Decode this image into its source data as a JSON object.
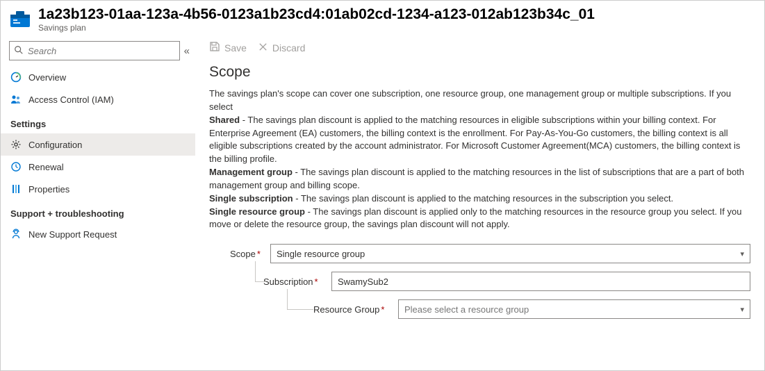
{
  "header": {
    "title": "1a23b123-01aa-123a-4b56-0123a1b23cd4:01ab02cd-1234-a123-012ab123b34c_01",
    "subtitle": "Savings plan"
  },
  "sidebar": {
    "search_placeholder": "Search",
    "items": {
      "overview": "Overview",
      "iam": "Access Control (IAM)",
      "configuration": "Configuration",
      "renewal": "Renewal",
      "properties": "Properties",
      "support": "New Support Request"
    },
    "sections": {
      "settings": "Settings",
      "support": "Support + troubleshooting"
    }
  },
  "toolbar": {
    "save": "Save",
    "discard": "Discard"
  },
  "scope": {
    "title": "Scope",
    "intro": "The savings plan's scope can cover one subscription, one resource group, one management group or multiple subscriptions. If you select",
    "shared_label": "Shared",
    "shared_text": " - The savings plan discount is applied to the matching resources in eligible subscriptions within your billing context. For Enterprise Agreement (EA) customers, the billing context is the enrollment. For Pay-As-You-Go customers, the billing context is all eligible subscriptions created by the account administrator. For Microsoft Customer Agreement(MCA) customers, the billing context is the billing profile.",
    "mg_label": "Management group",
    "mg_text": " - The savings plan discount is applied to the matching resources in the list of subscriptions that are a part of both management group and billing scope.",
    "ss_label": "Single subscription",
    "ss_text": " - The savings plan discount is applied to the matching resources in the subscription you select.",
    "srg_label": "Single resource group",
    "srg_text": " - The savings plan discount is applied only to the matching resources in the resource group you select. If you move or delete the resource group, the savings plan discount will not apply."
  },
  "form": {
    "scope_label": "Scope",
    "scope_value": "Single resource group",
    "subscription_label": "Subscription",
    "subscription_value": "SwamySub2",
    "rg_label": "Resource Group",
    "rg_placeholder": "Please select a resource group"
  }
}
